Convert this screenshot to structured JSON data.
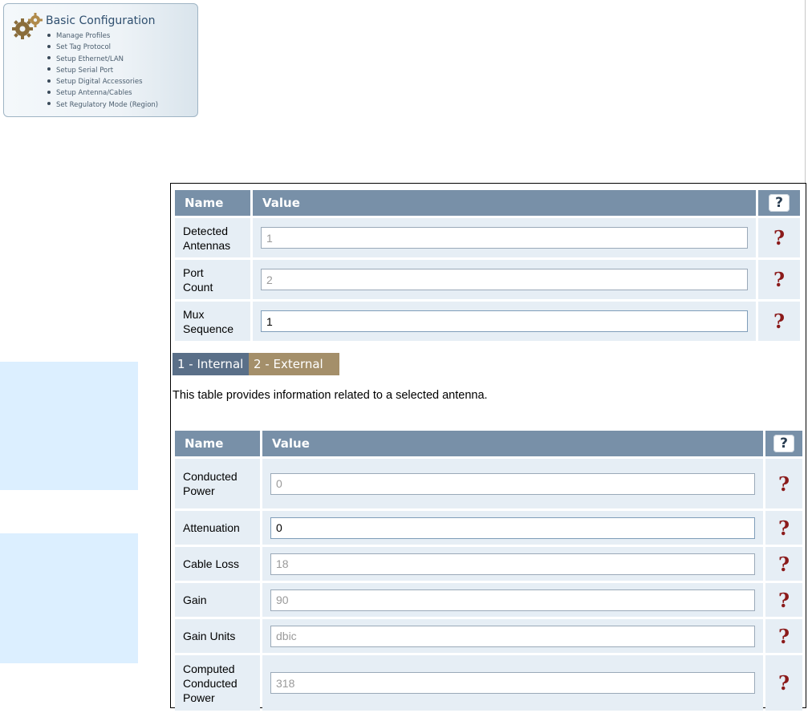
{
  "nav": {
    "title": "Basic Configuration",
    "items": [
      "Manage Profiles",
      "Set Tag Protocol",
      "Setup Ethernet/LAN",
      "Setup Serial Port",
      "Setup Digital Accessories",
      "Setup Antenna/Cables",
      "Set Regulatory Mode (Region)"
    ]
  },
  "top_table": {
    "col_name": "Name",
    "col_value": "Value",
    "help_header": "?",
    "help_symbol": "?",
    "rows": [
      {
        "line1": "Detected",
        "line2": "Antennas",
        "value": "1",
        "readonly": true
      },
      {
        "line1": "Port",
        "line2": "Count",
        "value": "2",
        "readonly": true
      },
      {
        "line1": "Mux",
        "line2": "Sequence",
        "value": "1",
        "readonly": false
      }
    ]
  },
  "tabs": [
    {
      "label": "1 - Internal",
      "active": true
    },
    {
      "label": "2 - External",
      "active": false
    }
  ],
  "description": "This table provides information related to a selected antenna.",
  "antenna_table": {
    "col_name": "Name",
    "col_value": "Value",
    "help_header": "?",
    "help_symbol": "?",
    "rows": [
      {
        "lines": [
          "Conducted",
          "Power"
        ],
        "value": "0",
        "readonly": true
      },
      {
        "lines": [
          "Attenuation"
        ],
        "value": "0",
        "readonly": false
      },
      {
        "lines": [
          "Cable Loss"
        ],
        "value": "18",
        "readonly": true
      },
      {
        "lines": [
          "Gain"
        ],
        "value": "90",
        "readonly": true
      },
      {
        "lines": [
          "Gain Units"
        ],
        "value": "dbic",
        "readonly": true
      },
      {
        "lines": [
          "Computed",
          "Conducted",
          "Power"
        ],
        "value": "318",
        "readonly": true
      }
    ]
  },
  "colors": {
    "header_bg": "#7890a8",
    "cell_bg": "#e6eef5",
    "tab_active": "#5a6f88",
    "tab_inactive": "#a48f6a",
    "help_red": "#8b1a1a",
    "side_panel": "#dcefff"
  }
}
